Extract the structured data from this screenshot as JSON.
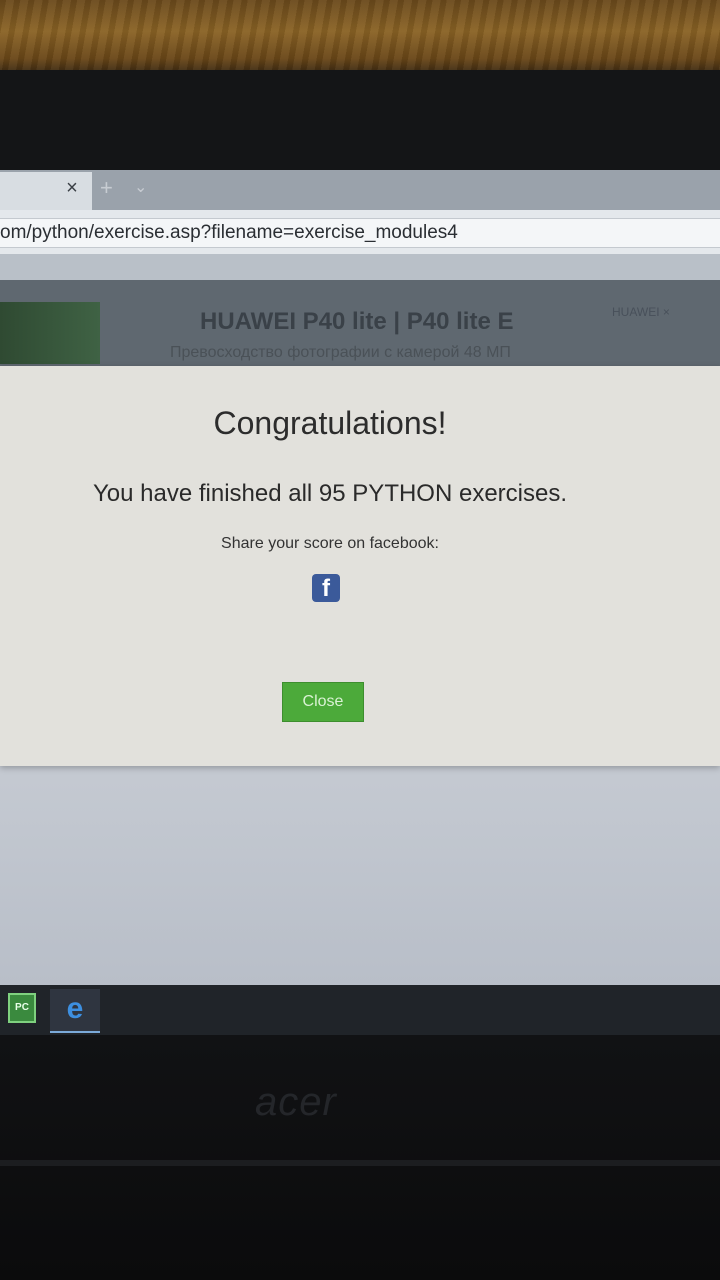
{
  "browser": {
    "tab_close": "×",
    "new_tab": "+",
    "tab_list": "⌄",
    "url": "om/python/exercise.asp?filename=exercise_modules4"
  },
  "ad": {
    "title": "HUAWEI P40 lite | P40 lite E",
    "subtitle": "Превосходство фотографии с камерой 48 МП",
    "brand": "HUAWEI",
    "close": "×"
  },
  "modal": {
    "title": "Congratulations!",
    "message": "You have finished all 95 PYTHON exercises.",
    "share_text": "Share your score on facebook:",
    "facebook_glyph": "f",
    "close_label": "Close"
  },
  "taskbar": {
    "pycharm_label": "PC",
    "ie_glyph": "e"
  },
  "laptop": {
    "brand": "acer"
  },
  "colors": {
    "close_button": "#4caa3a",
    "facebook": "#3b5a9a",
    "modal_bg": "#e2e1dc"
  }
}
